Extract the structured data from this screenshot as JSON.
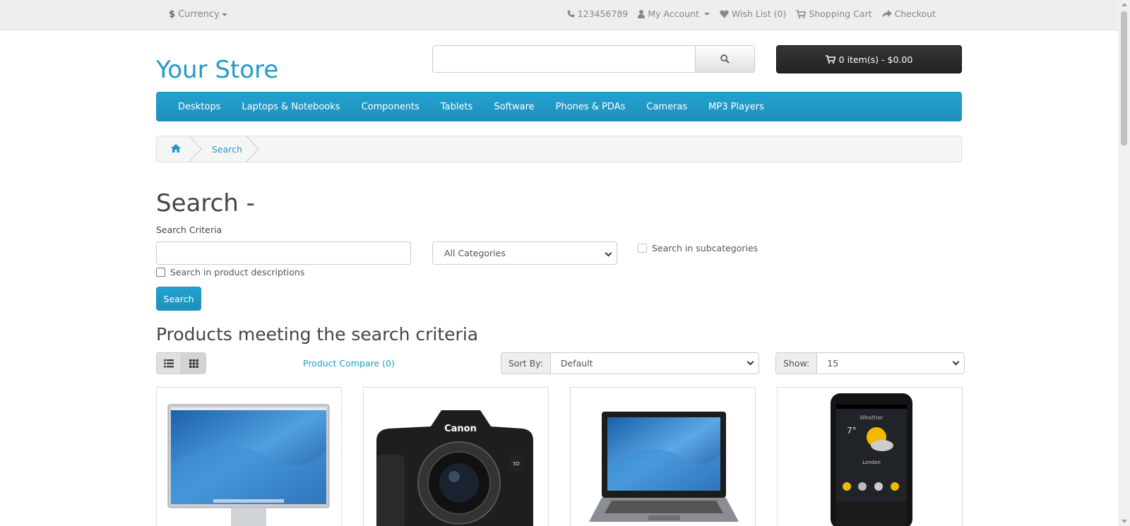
{
  "topbar": {
    "currency_symbol": "$",
    "currency_label": "Currency",
    "phone": "123456789",
    "my_account": "My Account",
    "wishlist": "Wish List (0)",
    "cart": "Shopping Cart",
    "checkout": "Checkout"
  },
  "header": {
    "logo": "Your Store",
    "search_placeholder": "",
    "cart_button": "0 item(s) - $0.00"
  },
  "menu": {
    "items": [
      "Desktops",
      "Laptops & Notebooks",
      "Components",
      "Tablets",
      "Software",
      "Phones & PDAs",
      "Cameras",
      "MP3 Players"
    ]
  },
  "breadcrumb": {
    "current": "Search"
  },
  "page": {
    "title": "Search -",
    "criteria_label": "Search Criteria",
    "criteria_value": "",
    "category_selected": "All Categories",
    "subcategories_label": "Search in subcategories",
    "descriptions_label": "Search in product descriptions",
    "search_button": "Search",
    "results_title": "Products meeting the search criteria",
    "compare_link": "Product Compare (0)",
    "sort_label": "Sort By:",
    "sort_value": "Default",
    "show_label": "Show:",
    "show_value": "15"
  },
  "products": [
    {
      "image": "apple-cinema-display"
    },
    {
      "image": "canon-eos-5d-camera"
    },
    {
      "image": "hp-laptop"
    },
    {
      "image": "htc-touch-hd-phone"
    }
  ],
  "colors": {
    "accent": "#229ac8",
    "menu_bg": "#229ac8",
    "cart_bg": "#303030",
    "topbar_bg": "#eeeeee"
  }
}
